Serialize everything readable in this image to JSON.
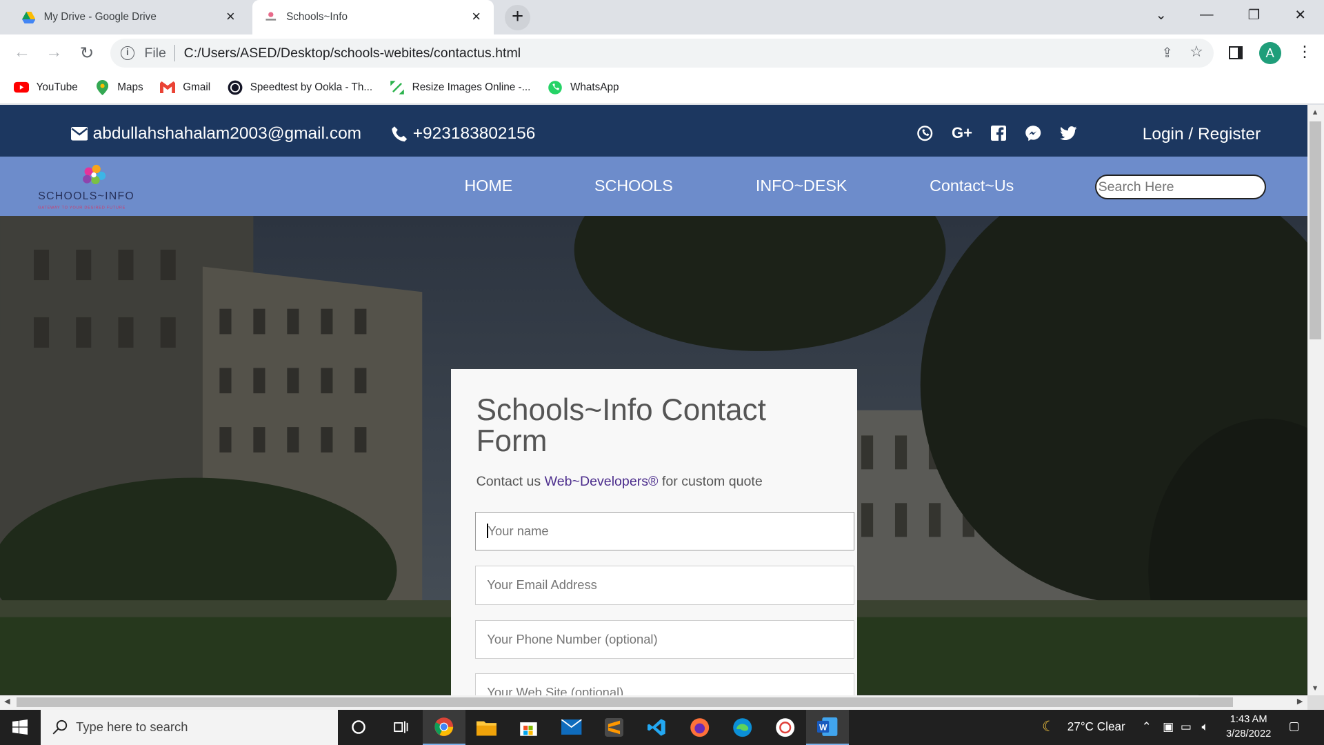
{
  "browser": {
    "tabs": [
      {
        "title": "My Drive - Google Drive",
        "icon": "google-drive-icon"
      },
      {
        "title": "Schools~Info",
        "icon": "schools-info-favicon"
      }
    ],
    "address": {
      "scheme_label": "File",
      "url": "C:/Users/ASED/Desktop/schools-webites/contactus.html"
    },
    "profile_initial": "A",
    "bookmarks": [
      {
        "label": "YouTube",
        "icon": "youtube-icon"
      },
      {
        "label": "Maps",
        "icon": "maps-icon"
      },
      {
        "label": "Gmail",
        "icon": "gmail-icon"
      },
      {
        "label": "Speedtest by Ookla - Th...",
        "icon": "speedtest-icon"
      },
      {
        "label": "Resize Images Online -...",
        "icon": "resize-images-icon"
      },
      {
        "label": "WhatsApp",
        "icon": "whatsapp-icon"
      }
    ]
  },
  "site": {
    "topbar": {
      "email": "abdullahshahalam2003@gmail.com",
      "phone": "+923183802156",
      "social": [
        "viber-icon",
        "google-plus-icon",
        "facebook-icon",
        "messenger-icon",
        "twitter-icon"
      ],
      "login": "Login / Register"
    },
    "logo": {
      "name": "SCHOOLS~INFO",
      "tagline": "GATEWAY TO YOUR DESIRED FUTURE"
    },
    "nav": [
      "HOME",
      "SCHOOLS",
      "INFO~DESK",
      "Contact~Us"
    ],
    "search_placeholder": "Search Here",
    "form": {
      "title": "Schools~Info Contact Form",
      "sub_prefix": "Contact us",
      "sub_accent": "Web~Developers®",
      "sub_suffix": "for custom quote",
      "fields": [
        "Your name",
        "Your Email Address",
        "Your Phone Number (optional)",
        "Your Web Site (optional)"
      ]
    }
  },
  "taskbar": {
    "search_placeholder": "Type here to search",
    "weather": "27°C  Clear",
    "time": "1:43 AM",
    "date": "3/28/2022"
  },
  "colors": {
    "topbar": "#1c3760",
    "navbar": "#6d8ccb",
    "accent": "#4b2c8c"
  }
}
